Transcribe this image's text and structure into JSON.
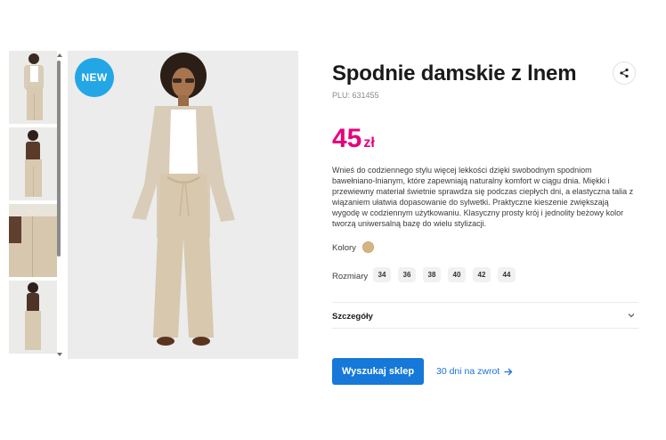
{
  "product": {
    "title": "Spodnie damskie z lnem",
    "plu": "PLU: 631455",
    "badge": "NEW",
    "price_amount": "45",
    "price_currency": "zł",
    "description": "Wnieś do codziennego stylu więcej lekkości dzięki swobodnym spodniom bawełniano-lnianym, które zapewniają naturalny komfort w ciągu dnia. Miękki i przewiewny materiał świetnie sprawdza się podczas ciepłych dni, a elastyczna talia z wiązaniem ułatwia dopasowanie do sylwetki. Praktyczne kieszenie zwiększają wygodę w codziennym użytkowaniu. Klasyczny prosty krój i jednolity beżowy kolor tworzą uniwersalną bazę do wielu stylizacji."
  },
  "options": {
    "colors_label": "Kolory",
    "color_value": "#d5b484",
    "sizes_label": "Rozmiary",
    "sizes": [
      "34",
      "36",
      "38",
      "40",
      "42",
      "44"
    ]
  },
  "details": {
    "label": "Szczegóły"
  },
  "actions": {
    "find_store": "Wyszukaj sklep",
    "returns": "30 dni na zwrot"
  },
  "icons": {
    "share": "share-icon",
    "chevron": "chevron-down-icon",
    "arrow": "arrow-right-icon"
  },
  "colors": {
    "price": "#e6007e",
    "cta": "#1678d8",
    "badge": "#23a6e6",
    "link": "#1a73d9"
  }
}
